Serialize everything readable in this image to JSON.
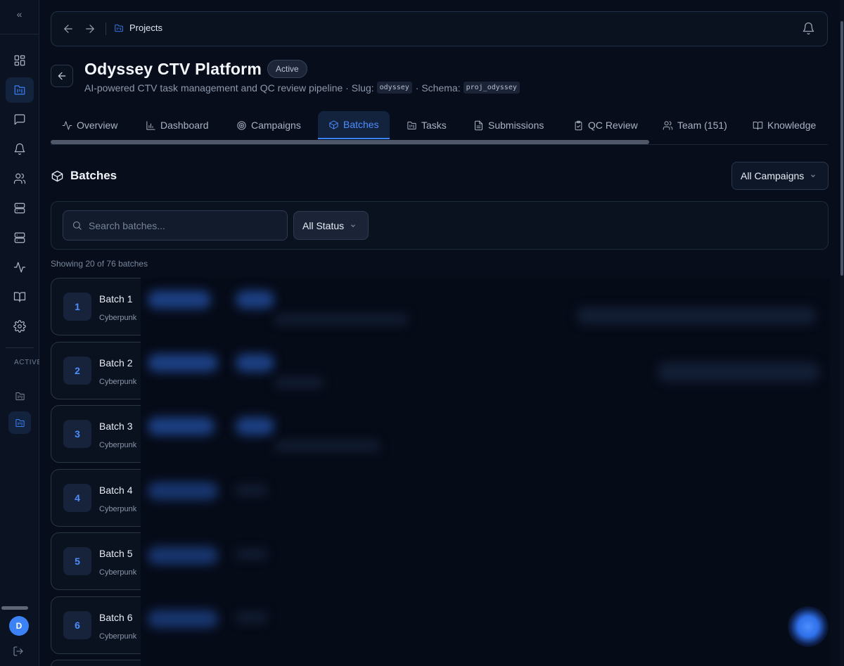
{
  "sidebar": {
    "collapse_label": "«",
    "section_label": "ACTIVE PROJECTS",
    "avatar_initial": "D",
    "icons": [
      "grid-icon",
      "folder-kanban-icon",
      "message-icon",
      "bell-icon",
      "users-icon",
      "server-icon",
      "database-icon",
      "activity-icon",
      "book-icon",
      "settings-icon"
    ]
  },
  "topbar": {
    "breadcrumb": "Projects"
  },
  "project": {
    "title": "Odyssey CTV Platform",
    "status": "Active",
    "description": "AI-powered CTV task management and QC review pipeline · Slug:",
    "slug": "odyssey",
    "schema_label": "· Schema:",
    "schema": "proj_odyssey"
  },
  "tabs": [
    {
      "label": "Overview",
      "icon": "activity-icon"
    },
    {
      "label": "Dashboard",
      "icon": "bar-chart-icon"
    },
    {
      "label": "Campaigns",
      "icon": "target-icon"
    },
    {
      "label": "Batches",
      "icon": "package-icon",
      "active": true
    },
    {
      "label": "Tasks",
      "icon": "folder-icon"
    },
    {
      "label": "Submissions",
      "icon": "file-icon"
    },
    {
      "label": "QC Review",
      "icon": "clipboard-check-icon"
    },
    {
      "label": "Team (151)",
      "icon": "users-icon"
    },
    {
      "label": "Knowledge",
      "icon": "book-icon"
    }
  ],
  "batches_section": {
    "title": "Batches",
    "campaign_filter": "All Campaigns",
    "search_placeholder": "Search batches...",
    "status_filter": "All Status",
    "showing": "Showing 20 of 76 batches"
  },
  "batches": [
    {
      "num": "1",
      "name": "Batch 1",
      "campaign": "Cyberpunk"
    },
    {
      "num": "2",
      "name": "Batch 2",
      "campaign": "Cyberpunk"
    },
    {
      "num": "3",
      "name": "Batch 3",
      "campaign": "Cyberpunk"
    },
    {
      "num": "4",
      "name": "Batch 4",
      "campaign": "Cyberpunk"
    },
    {
      "num": "5",
      "name": "Batch 5",
      "campaign": "Cyberpunk"
    },
    {
      "num": "6",
      "name": "Batch 6",
      "campaign": "Cyberpunk"
    }
  ],
  "colors": {
    "accent": "#3b82f6",
    "background": "#070d1a",
    "card": "#0a1220"
  }
}
